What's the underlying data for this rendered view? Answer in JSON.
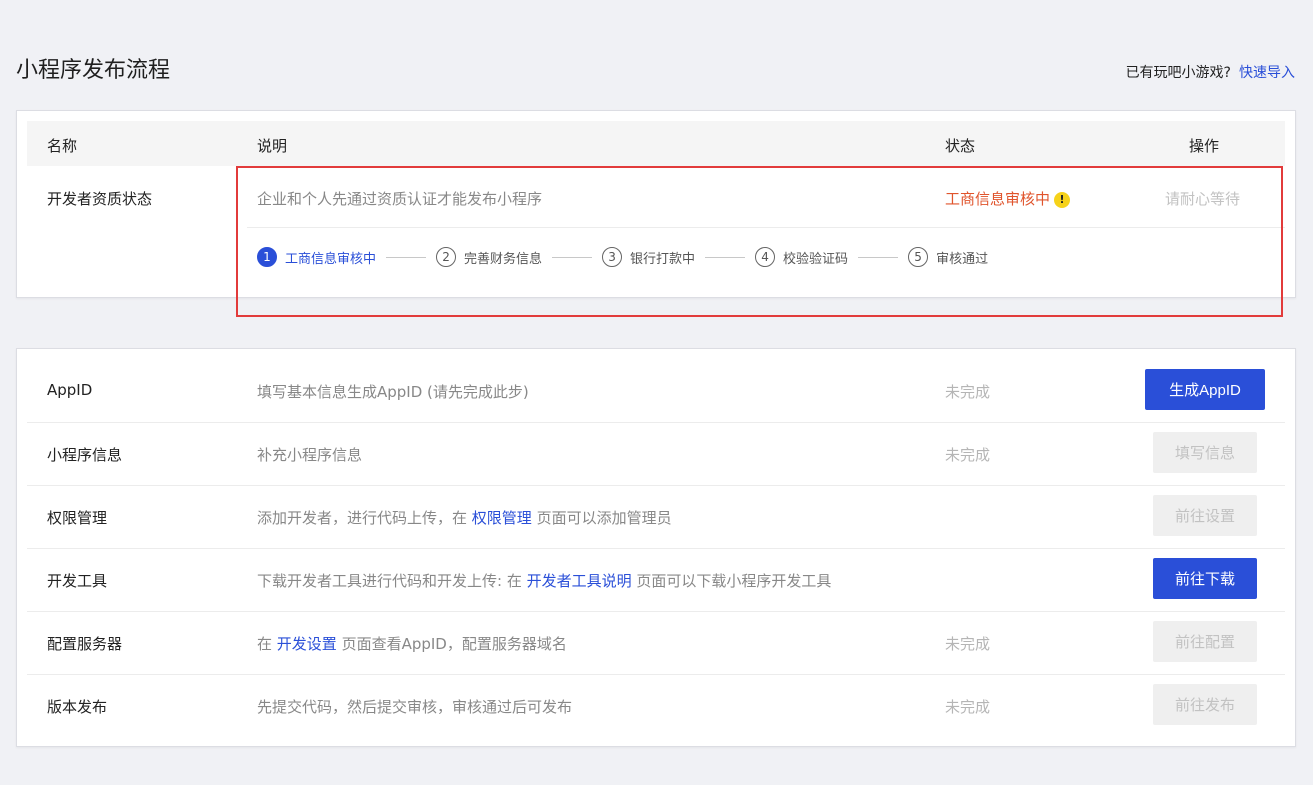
{
  "header": {
    "title": "小程序发布流程",
    "question": "已有玩吧小游戏?",
    "import_link": "快速导入"
  },
  "table_header": {
    "name": "名称",
    "desc": "说明",
    "status": "状态",
    "op": "操作"
  },
  "qualification": {
    "name": "开发者资质状态",
    "desc": "企业和个人先通过资质认证才能发布小程序",
    "status": "工商信息审核中",
    "status_icon": "!",
    "op": "请耐心等待",
    "steps": [
      {
        "num": "1",
        "label": "工商信息审核中"
      },
      {
        "num": "2",
        "label": "完善财务信息"
      },
      {
        "num": "3",
        "label": "银行打款中"
      },
      {
        "num": "4",
        "label": "校验验证码"
      },
      {
        "num": "5",
        "label": "审核通过"
      }
    ]
  },
  "rows": [
    {
      "name": "AppID",
      "desc": "填写基本信息生成AppID (请先完成此步)",
      "status": "未完成",
      "button": "生成AppID"
    },
    {
      "name": "小程序信息",
      "desc": "补充小程序信息",
      "status": "未完成",
      "button": "填写信息"
    },
    {
      "name": "权限管理",
      "desc_pre": "添加开发者，进行代码上传，在 ",
      "desc_link": "权限管理",
      "desc_post": " 页面可以添加管理员",
      "status": "",
      "button": "前往设置"
    },
    {
      "name": "开发工具",
      "desc_pre": "下载开发者工具进行代码和开发上传: 在 ",
      "desc_link": "开发者工具说明",
      "desc_post": " 页面可以下载小程序开发工具",
      "status": "",
      "button": "前往下载"
    },
    {
      "name": "配置服务器",
      "desc_pre": "在 ",
      "desc_link": "开发设置",
      "desc_post": " 页面查看AppID，配置服务器域名",
      "status": "未完成",
      "button": "前往配置"
    },
    {
      "name": "版本发布",
      "desc": "先提交代码，然后提交审核，审核通过后可发布",
      "status": "未完成",
      "button": "前往发布"
    }
  ],
  "colors": {
    "accent": "#2a4fd8",
    "warning": "#e0542c",
    "highlight": "#e23b3b"
  }
}
